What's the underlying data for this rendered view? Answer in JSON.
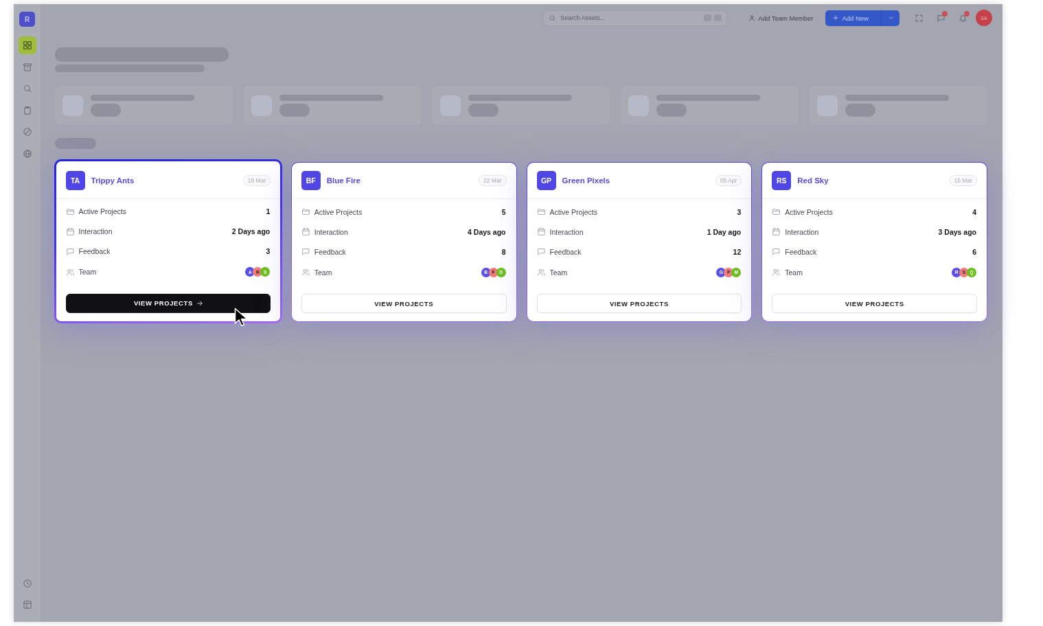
{
  "sidebar": {
    "logo": "R",
    "items": [
      {
        "selected": true
      },
      {
        "selected": false
      },
      {
        "selected": false
      },
      {
        "selected": false
      },
      {
        "selected": false
      },
      {
        "selected": false
      }
    ],
    "bottom_items": [
      {
        "selected": false
      },
      {
        "selected": false
      }
    ]
  },
  "topbar": {
    "search": {
      "placeholder": "Search Assets..."
    },
    "add_member": {
      "label": "Add Team Member"
    },
    "add_new": {
      "label": "Add New"
    },
    "icons": [
      {
        "badge": false
      },
      {
        "badge": true
      },
      {
        "badge": true
      }
    ],
    "avatar": {
      "initials": "SA"
    }
  },
  "cards": [
    {
      "initials": "TA",
      "name": "Trippy Ants",
      "date": "18 Mar",
      "selected": true,
      "stats": [
        {
          "label": "Active Projects",
          "value": "1"
        },
        {
          "label": "Interaction",
          "value": "2 Days ago"
        },
        {
          "label": "Feedback",
          "value": "3"
        }
      ],
      "team": {
        "label": "Team",
        "members": [
          {
            "initial": "A",
            "color": "#5b4fe9"
          },
          {
            "initial": "R",
            "color": "#f27b7b"
          },
          {
            "initial": "S",
            "color": "#6cc01e"
          }
        ]
      },
      "button": "VIEW PROJECTS"
    },
    {
      "initials": "BF",
      "name": "Blue Fire",
      "date": "22 Mar",
      "selected": false,
      "stats": [
        {
          "label": "Active Projects",
          "value": "5"
        },
        {
          "label": "Interaction",
          "value": "4 Days ago"
        },
        {
          "label": "Feedback",
          "value": "8"
        }
      ],
      "team": {
        "label": "Team",
        "members": [
          {
            "initial": "B",
            "color": "#5b4fe9"
          },
          {
            "initial": "F",
            "color": "#f27b7b"
          },
          {
            "initial": "D",
            "color": "#6cc01e"
          }
        ]
      },
      "button": "VIEW PROJECTS"
    },
    {
      "initials": "GP",
      "name": "Green Pixels",
      "date": "05 Apr",
      "selected": false,
      "stats": [
        {
          "label": "Active Projects",
          "value": "3"
        },
        {
          "label": "Interaction",
          "value": "1 Day ago"
        },
        {
          "label": "Feedback",
          "value": "12"
        }
      ],
      "team": {
        "label": "Team",
        "members": [
          {
            "initial": "G",
            "color": "#5b4fe9"
          },
          {
            "initial": "P",
            "color": "#f27b7b"
          },
          {
            "initial": "M",
            "color": "#6cc01e"
          }
        ]
      },
      "button": "VIEW PROJECTS"
    },
    {
      "initials": "RS",
      "name": "Red Sky",
      "date": "15 Mar",
      "selected": false,
      "stats": [
        {
          "label": "Active Projects",
          "value": "4"
        },
        {
          "label": "Interaction",
          "value": "3 Days ago"
        },
        {
          "label": "Feedback",
          "value": "6"
        }
      ],
      "team": {
        "label": "Team",
        "members": [
          {
            "initial": "R",
            "color": "#5b4fe9"
          },
          {
            "initial": "S",
            "color": "#f27b7b"
          },
          {
            "initial": "Q",
            "color": "#6cc01e"
          }
        ]
      },
      "button": "VIEW PROJECTS"
    }
  ]
}
